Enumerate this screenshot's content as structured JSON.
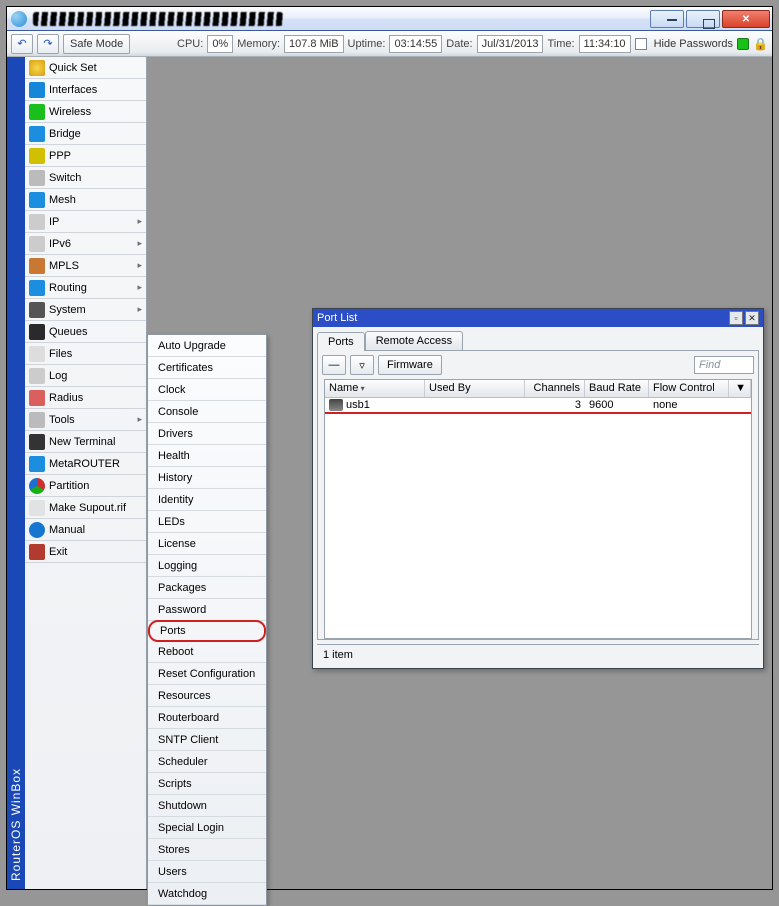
{
  "titlebar": {
    "min_tip": "Minimize",
    "max_tip": "Maximize",
    "close_tip": "Close"
  },
  "toolbar": {
    "safe_mode": "Safe Mode",
    "cpu_label": "CPU:",
    "cpu_value": "0%",
    "memory_label": "Memory:",
    "memory_value": "107.8 MiB",
    "uptime_label": "Uptime:",
    "uptime_value": "03:14:55",
    "date_label": "Date:",
    "date_value": "Jul/31/2013",
    "time_label": "Time:",
    "time_value": "11:34:10",
    "hide_pw": "Hide Passwords"
  },
  "brand": "RouterOS WinBox",
  "sidebar": {
    "items": [
      {
        "label": "Quick Set",
        "icon": "ic-quick",
        "chevron": false
      },
      {
        "label": "Interfaces",
        "icon": "ic-interfaces",
        "chevron": false
      },
      {
        "label": "Wireless",
        "icon": "ic-wireless",
        "chevron": false
      },
      {
        "label": "Bridge",
        "icon": "ic-bridge",
        "chevron": false
      },
      {
        "label": "PPP",
        "icon": "ic-ppp",
        "chevron": false
      },
      {
        "label": "Switch",
        "icon": "ic-switch",
        "chevron": false
      },
      {
        "label": "Mesh",
        "icon": "ic-mesh",
        "chevron": false
      },
      {
        "label": "IP",
        "icon": "ic-ip",
        "chevron": true
      },
      {
        "label": "IPv6",
        "icon": "ic-ipv6",
        "chevron": true
      },
      {
        "label": "MPLS",
        "icon": "ic-mpls",
        "chevron": true
      },
      {
        "label": "Routing",
        "icon": "ic-routing",
        "chevron": true
      },
      {
        "label": "System",
        "icon": "ic-system",
        "chevron": true
      },
      {
        "label": "Queues",
        "icon": "ic-queues",
        "chevron": false
      },
      {
        "label": "Files",
        "icon": "ic-files",
        "chevron": false
      },
      {
        "label": "Log",
        "icon": "ic-log",
        "chevron": false
      },
      {
        "label": "Radius",
        "icon": "ic-radius",
        "chevron": false
      },
      {
        "label": "Tools",
        "icon": "ic-tools",
        "chevron": true
      },
      {
        "label": "New Terminal",
        "icon": "ic-terminal",
        "chevron": false
      },
      {
        "label": "MetaROUTER",
        "icon": "ic-metarouter",
        "chevron": false
      },
      {
        "label": "Partition",
        "icon": "ic-partition",
        "chevron": false
      },
      {
        "label": "Make Supout.rif",
        "icon": "ic-supout",
        "chevron": false
      },
      {
        "label": "Manual",
        "icon": "ic-manual",
        "chevron": false
      },
      {
        "label": "Exit",
        "icon": "ic-exit",
        "chevron": false
      }
    ]
  },
  "submenu": {
    "items": [
      "Auto Upgrade",
      "Certificates",
      "Clock",
      "Console",
      "Drivers",
      "Health",
      "History",
      "Identity",
      "LEDs",
      "License",
      "Logging",
      "Packages",
      "Password",
      "Ports",
      "Reboot",
      "Reset Configuration",
      "Resources",
      "Routerboard",
      "SNTP Client",
      "Scheduler",
      "Scripts",
      "Shutdown",
      "Special Login",
      "Stores",
      "Users",
      "Watchdog"
    ],
    "highlight": "Ports"
  },
  "portlist": {
    "title": "Port List",
    "tabs": [
      "Ports",
      "Remote Access"
    ],
    "toolbar": {
      "firmware": "Firmware",
      "find_placeholder": "Find"
    },
    "columns": [
      "Name",
      "Used By",
      "Channels",
      "Baud Rate",
      "Flow Control"
    ],
    "rows": [
      {
        "name": "usb1",
        "used_by": "",
        "channels": "3",
        "baud": "9600",
        "flow": "none"
      }
    ],
    "status": "1 item"
  }
}
